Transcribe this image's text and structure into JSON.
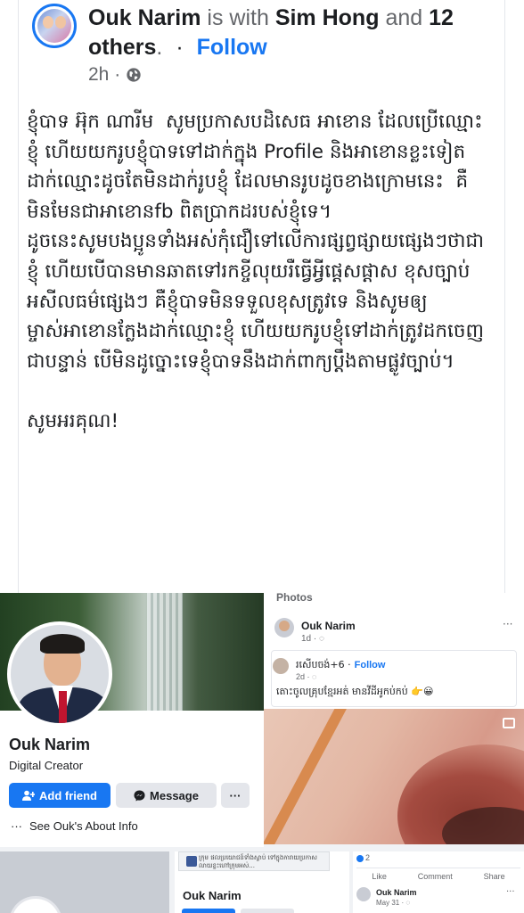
{
  "header": {
    "author": "Ouk Narim",
    "with_text": "is with",
    "tagged": "Sim Hong",
    "and_text": "and",
    "others": "12 others",
    "separator": "·",
    "follow_label": "Follow",
    "time": "2h ·",
    "privacy_icon": "globe-icon"
  },
  "post": {
    "body": "ខ្ញុំបាទ អ៊ុក ណារីម  សូមប្រកាសបដិសេធ អាខោន ដែលប្រើឈ្មោះខ្ញុំ ហើយយករូបខ្ញុំបាទទៅដាក់ក្នុង Profile និងអាខោនខ្លះទៀត ដាក់ឈ្មោះដូចតែមិនដាក់រូបខ្ញុំ ដែលមានរូបដូចខាងក្រោមនេះ  គឺមិនមែនជាអាខោនfb ពិតប្រាកដរបស់ខ្ញុំទេ។\nដូចនេះសូមបងប្អូនទាំងអស់កុំជឿទៅលើការផ្សព្វផ្សាយផ្សេងៗថាជាខ្ញុំ ហើយបើបានមានឆាតទៅរកខ្ចីលុយរឺធ្វើអ្វីផ្តេសផ្តាស ខុសច្បាប់  អសីលធម៌ផ្សេងៗ គឺខ្ញុំបាទមិនទទួលខុសត្រូវទេ និងសូមឲ្យម្ចាស់អាខោនក្លែងដាក់ឈ្មោះខ្ញុំ ហើយយករូបខ្ញុំទៅដាក់ត្រូវដកចេញជាបន្ទាន់ បើមិនដូច្នោះទេខ្ញុំបាទនឹងដាក់ពាក្យប្តឹងតាមផ្លូវច្បាប់។\n\nសូមអរគុណ!"
  },
  "profile_shot": {
    "name": "Ouk Narim",
    "subtitle": "Digital Creator",
    "add_friend_label": "Add friend",
    "message_label": "Message",
    "more_label": "···",
    "about_label": "See Ouk's About Info",
    "about_dots": "···"
  },
  "post_shot": {
    "photos_label": "Photos",
    "name": "Ouk Narim",
    "time": "1d · ◌",
    "menu": "···",
    "shared_name": "រសើបចង់+6 ·",
    "shared_follow": "Follow",
    "shared_time": "2d · ◌",
    "shared_text": "តោះចូលគ្រុបខ្មែរអត់ មានវីដីអូកប់កប់ 👉😀"
  },
  "bottom": {
    "banner_text": "ក្រុម ផលប្រយោជន៍ទាំងស្លាប់ ទៅក្នុងការាយប្រកាសលាយខ្លះហៅក្រុមអស់...",
    "mid_name": "Ouk Narim",
    "reaction_count": "2",
    "like_label": "Like",
    "comment_label": "Comment",
    "share_label": "Share",
    "right_name": "Ouk Narim",
    "right_date": "May 31 · ◌",
    "right_dots": "···"
  }
}
